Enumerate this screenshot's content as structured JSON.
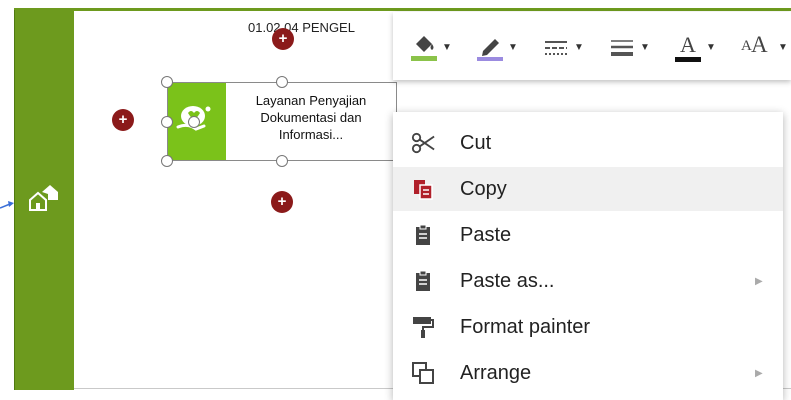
{
  "lane": {
    "title": "01.02.04 PENGEL",
    "house_icon": "house-icon"
  },
  "task": {
    "label": "Layanan Penyajian Dokumentasi dan Informasi...",
    "icon": "hand-heart-icon"
  },
  "toolbar": {
    "buttons": [
      {
        "name": "fill-color-button",
        "icon": "paint-bucket-icon"
      },
      {
        "name": "line-color-button",
        "icon": "pen-icon"
      },
      {
        "name": "line-style-button",
        "icon": "dash-lines-icon"
      },
      {
        "name": "line-weight-button",
        "icon": "line-weight-icon"
      },
      {
        "name": "font-color-button",
        "icon": "font-color-icon"
      },
      {
        "name": "font-size-button",
        "icon": "font-size-icon"
      }
    ],
    "font_color_glyph": "A",
    "font_size_glyph": "A",
    "font_size_small_glyph": "A"
  },
  "context_menu": {
    "items": [
      {
        "label": "Cut",
        "icon": "scissors-icon",
        "submenu": false
      },
      {
        "label": "Copy",
        "icon": "copy-icon",
        "submenu": false,
        "active": true
      },
      {
        "label": "Paste",
        "icon": "clipboard-icon",
        "submenu": false
      },
      {
        "label": "Paste as...",
        "icon": "clipboard-icon",
        "submenu": true
      },
      {
        "label": "Format painter",
        "icon": "paint-roller-icon",
        "submenu": false
      },
      {
        "label": "Arrange",
        "icon": "arrange-icon",
        "submenu": true
      }
    ]
  },
  "colors": {
    "lane_green": "#6d9a1e",
    "task_icon_green": "#7bc21a",
    "marker_red": "#8b1a1a",
    "copy_icon_red": "#b0202a"
  },
  "markers": {
    "plus_glyph": "+"
  }
}
